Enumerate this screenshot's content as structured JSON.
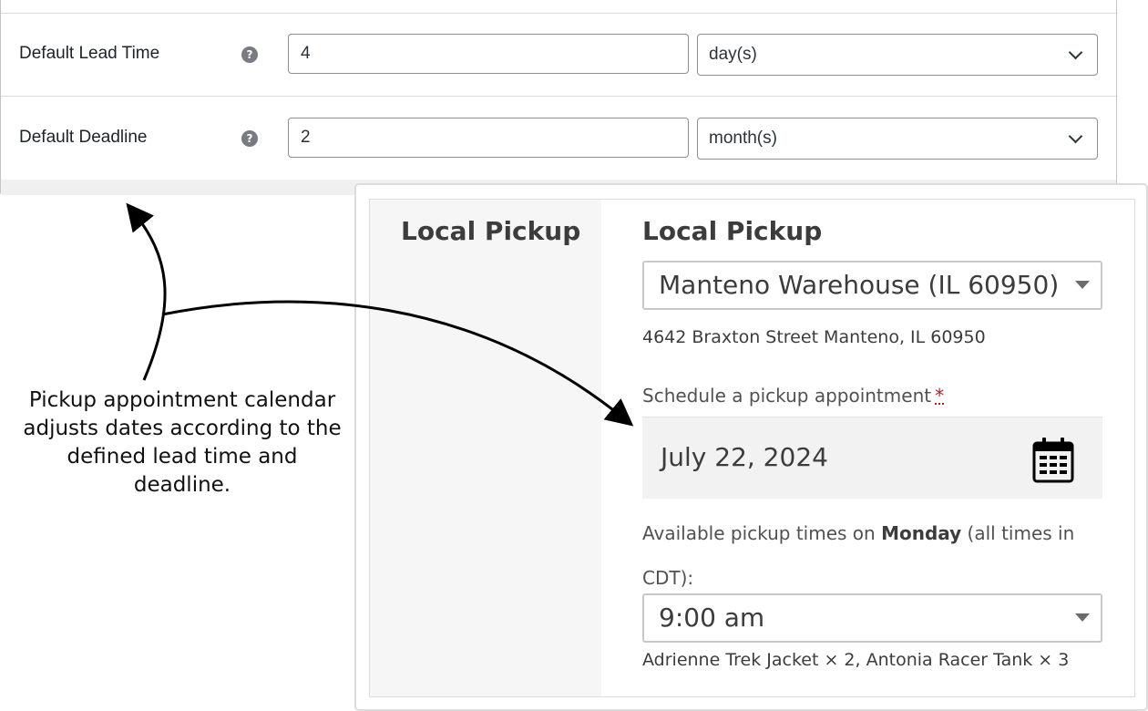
{
  "settings": {
    "rows": [
      {
        "label": "Default Lead Time",
        "help_icon": "question-circle-icon",
        "value": "4",
        "unit": "day(s)"
      },
      {
        "label": "Default Deadline",
        "help_icon": "question-circle-icon",
        "value": "2",
        "unit": "month(s)"
      }
    ]
  },
  "annotation": {
    "text": "Pickup appointment calendar adjusts dates according to the defined lead time and deadline."
  },
  "checkout": {
    "column_label": "Local Pickup",
    "field_title": "Local Pickup",
    "location": "Manteno Warehouse (IL 60950)",
    "address": "4642 Braxton Street Manteno, IL 60950",
    "schedule_label": "Schedule a pickup appointment",
    "required_mark": "*",
    "date": "July 22, 2024",
    "calendar_icon": "calendar-icon",
    "available_prefix": "Available pickup times on ",
    "available_day": "Monday",
    "available_suffix": " (all times in CDT):",
    "time": "9:00 am",
    "items": "Adrienne Trek Jacket × 2, Antonia Racer Tank × 3"
  },
  "colors": {
    "border": "#c3c4c7",
    "required": "#b81c23",
    "date_field_bg": "#f2f2f2",
    "label_column_bg": "#f6f6f6"
  }
}
